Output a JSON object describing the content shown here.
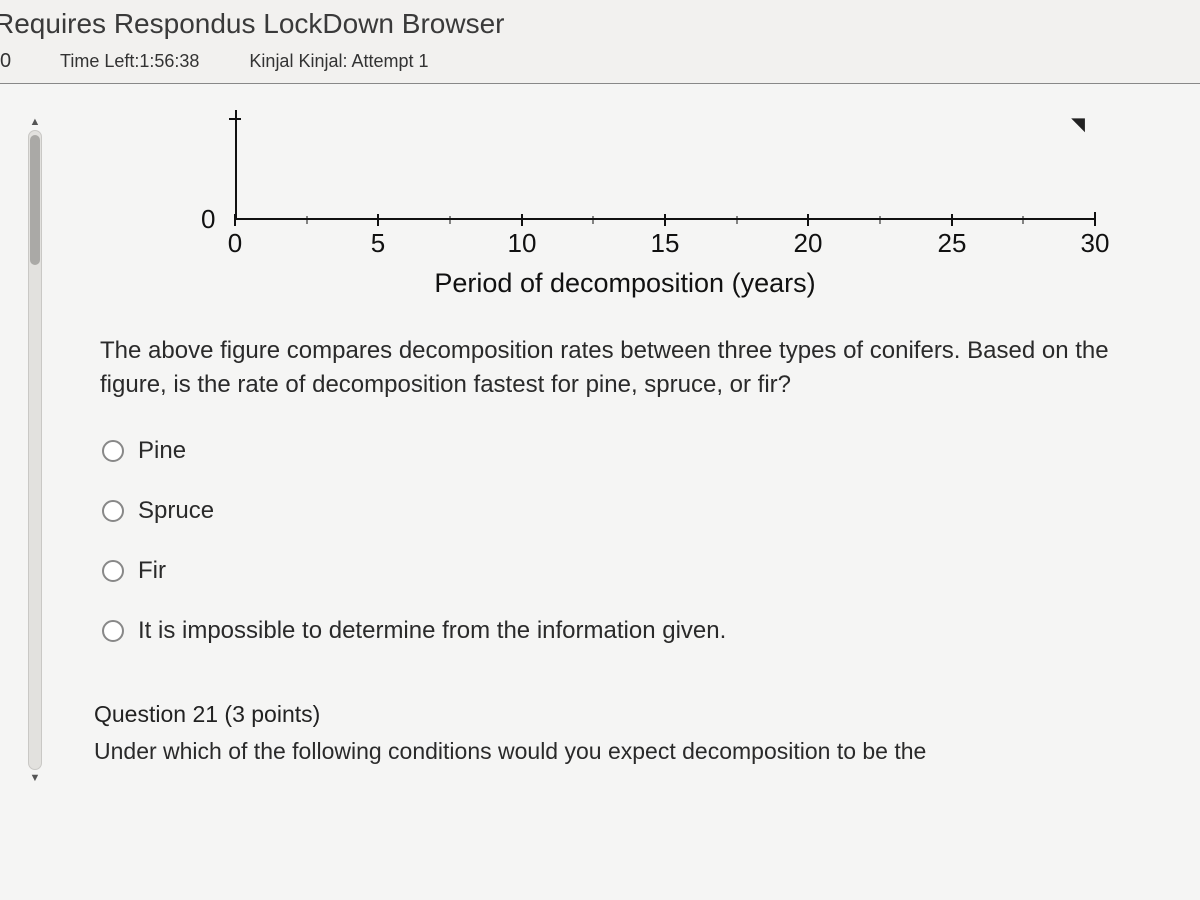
{
  "header": {
    "title": "Requires Respondus LockDown Browser",
    "left_number": "0",
    "time_left_label": "Time Left:",
    "time_left_value": "1:56:38",
    "user_attempt": "Kinjal Kinjal: Attempt 1"
  },
  "chart_data": {
    "type": "line",
    "title": "",
    "xlabel": "Period of decomposition (years)",
    "ylabel": "",
    "x_ticks": [
      0,
      5,
      10,
      15,
      20,
      25,
      30
    ],
    "xlim": [
      0,
      30
    ],
    "ylim": [
      0,
      null
    ],
    "y_visible_tick": 0,
    "series": [],
    "note": "Only the x-axis and the y=0 tick are visible in the cropped figure; data series are not shown."
  },
  "question": {
    "prompt": "The above figure compares decomposition rates between three types of conifers. Based on the figure, is the rate of decomposition fastest for pine, spruce, or fir?",
    "options": [
      {
        "label": "Pine"
      },
      {
        "label": "Spruce"
      },
      {
        "label": "Fir"
      },
      {
        "label": "It is impossible to determine from the information given."
      }
    ]
  },
  "next_question": {
    "number_label": "Question 21",
    "points_label": "(3 points)",
    "partial_text": "Under which of the following conditions would you expect decomposition to be the"
  }
}
